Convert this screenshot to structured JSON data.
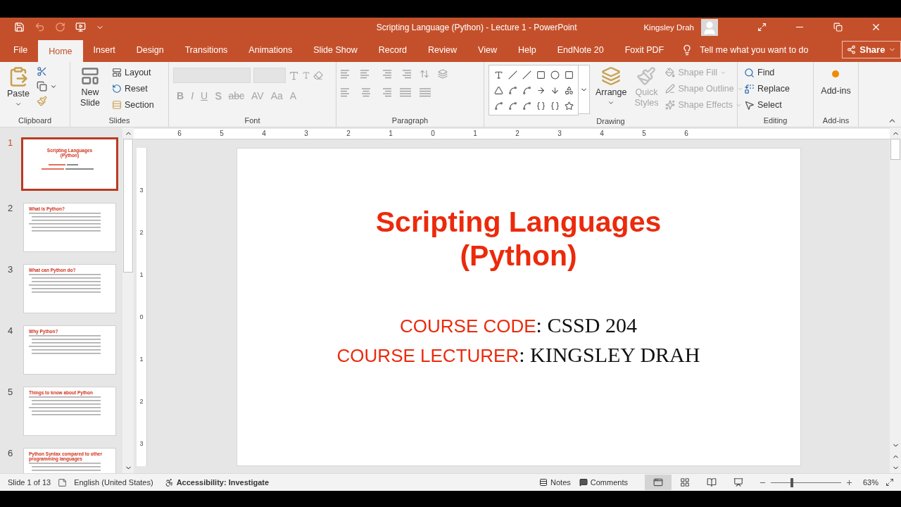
{
  "title_bar": {
    "title": "Scripting Language (Python) - Lecture 1  -  PowerPoint",
    "user": "Kingsley Drah"
  },
  "tabs": [
    {
      "label": "File",
      "selected": false
    },
    {
      "label": "Home",
      "selected": true
    },
    {
      "label": "Insert",
      "selected": false
    },
    {
      "label": "Design",
      "selected": false
    },
    {
      "label": "Transitions",
      "selected": false
    },
    {
      "label": "Animations",
      "selected": false
    },
    {
      "label": "Slide Show",
      "selected": false
    },
    {
      "label": "Record",
      "selected": false
    },
    {
      "label": "Review",
      "selected": false
    },
    {
      "label": "View",
      "selected": false
    },
    {
      "label": "Help",
      "selected": false
    },
    {
      "label": "EndNote 20",
      "selected": false
    },
    {
      "label": "Foxit PDF",
      "selected": false
    }
  ],
  "tell_me": {
    "placeholder": "Tell me what you want to do"
  },
  "share": "Share",
  "ribbon": {
    "clipboard": {
      "label": "Clipboard",
      "paste": "Paste"
    },
    "slides": {
      "label": "Slides",
      "new_slide": "New Slide",
      "items": [
        "Layout",
        "Reset",
        "Section"
      ]
    },
    "font": {
      "label": "Font",
      "disabled": true,
      "buttons": [
        {
          "text": "B",
          "kind": "bold"
        },
        {
          "text": "I",
          "kind": "italic"
        },
        {
          "text": "U",
          "kind": "underline"
        },
        {
          "text": "S",
          "kind": "shadow"
        },
        {
          "text": "abc",
          "kind": "strike"
        },
        {
          "text": "AV",
          "kind": "spacing"
        },
        {
          "text": "Aa",
          "kind": "case"
        },
        {
          "text": "A",
          "kind": "color"
        }
      ]
    },
    "paragraph": {
      "label": "Paragraph",
      "disabled": true
    },
    "drawing": {
      "label": "Drawing",
      "arrange": "Arrange",
      "quick_styles": {
        "label": "Quick Styles",
        "disabled": true
      },
      "shape_items": [
        {
          "label": "Shape Fill",
          "kind": "fill",
          "disabled": true
        },
        {
          "label": "Shape Outline",
          "kind": "outline",
          "disabled": true
        },
        {
          "label": "Shape Effects",
          "kind": "effects",
          "disabled": true
        }
      ]
    },
    "editing": {
      "label": "Editing",
      "items": [
        {
          "label": "Find",
          "kind": "find"
        },
        {
          "label": "Replace",
          "kind": "replace"
        },
        {
          "label": "Select",
          "kind": "select"
        }
      ]
    },
    "addins": {
      "label": "Add-ins",
      "button": "Add-ins"
    }
  },
  "thumbnails": [
    {
      "number": "1",
      "selected": true,
      "kind": "title",
      "title": "Scripting Languages (Python)"
    },
    {
      "number": "2",
      "selected": false,
      "kind": "content",
      "title": "What is Python?"
    },
    {
      "number": "3",
      "selected": false,
      "kind": "content",
      "title": "What can Python do?"
    },
    {
      "number": "4",
      "selected": false,
      "kind": "content",
      "title": "Why Python?"
    },
    {
      "number": "5",
      "selected": false,
      "kind": "content",
      "title": "Things to know about Python"
    },
    {
      "number": "6",
      "selected": false,
      "kind": "content",
      "title": "Python Syntax compared to other programming languages"
    }
  ],
  "ruler": {
    "horizontal": [
      "6",
      "5",
      "4",
      "3",
      "2",
      "1",
      "0",
      "1",
      "2",
      "3",
      "4",
      "5",
      "6"
    ],
    "vertical": [
      "3",
      "2",
      "1",
      "0",
      "1",
      "2",
      "3"
    ]
  },
  "slide": {
    "title": "Scripting Languages (Python)",
    "lines": [
      {
        "label": "COURSE CODE",
        "value": ": CSSD 204"
      },
      {
        "label": "COURSE LECTURER",
        "value": ": KINGSLEY DRAH"
      }
    ]
  },
  "status_bar": {
    "slide": "Slide 1 of 13",
    "language": "English (United States)",
    "accessibility": "Accessibility: Investigate",
    "notes": "Notes",
    "comments": "Comments",
    "views": [
      {
        "kind": "normal",
        "selected": true
      },
      {
        "kind": "sorter",
        "selected": false
      },
      {
        "kind": "reading",
        "selected": false
      },
      {
        "kind": "show",
        "selected": false
      }
    ],
    "zoom_slider": {
      "level": 0.3
    },
    "zoom": "63%"
  }
}
